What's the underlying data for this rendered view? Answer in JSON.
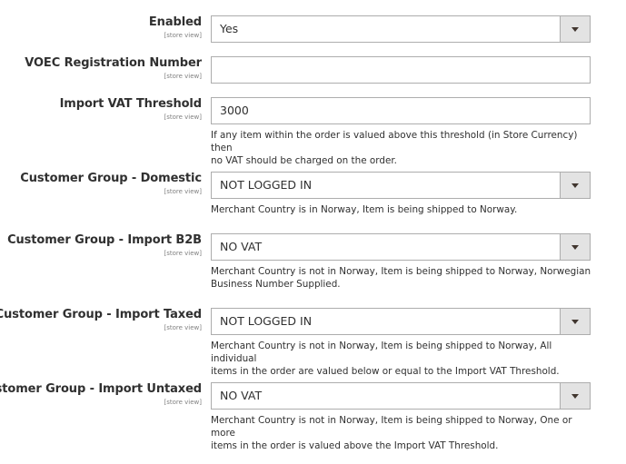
{
  "scope_label": "[store view]",
  "fields": {
    "enabled": {
      "label": "Enabled",
      "value": "Yes"
    },
    "voec": {
      "label": "VOEC Registration Number",
      "value": ""
    },
    "threshold": {
      "label": "Import VAT Threshold",
      "value": "3000",
      "note_line1": "If any item within the order is valued above this threshold (in Store Currency) then",
      "note_line2": "no VAT should be charged on the order."
    },
    "domestic": {
      "label": "Customer Group - Domestic",
      "value": "NOT LOGGED IN",
      "note_line1": "Merchant Country is in Norway, Item is being shipped to Norway."
    },
    "b2b": {
      "label": "Customer Group - Import B2B",
      "value": "NO VAT",
      "note_line1": "Merchant Country is not in Norway, Item is being shipped to Norway, Norwegian",
      "note_line2": "Business Number Supplied."
    },
    "taxed": {
      "label": "Customer Group - Import Taxed",
      "value": "NOT LOGGED IN",
      "note_line1": "Merchant Country is not in Norway, Item is being shipped to Norway, All individual",
      "note_line2": "items in the order are valued below or equal to the Import VAT Threshold."
    },
    "untaxed": {
      "label": "Customer Group - Import Untaxed",
      "value": "NO VAT",
      "note_line1": "Merchant Country is not in Norway, Item is being shipped to Norway, One or more",
      "note_line2": "items in the order is valued above the Import VAT Threshold."
    }
  }
}
